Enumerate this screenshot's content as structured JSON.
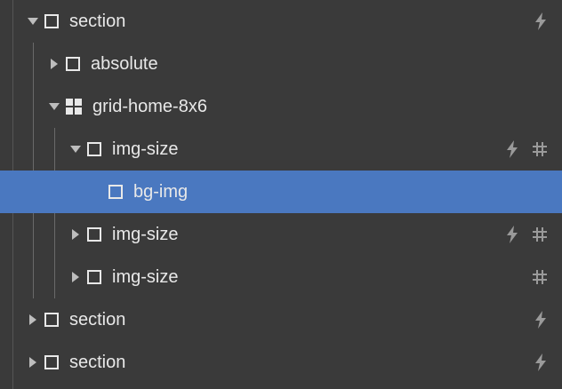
{
  "tree": {
    "items": [
      {
        "label": "section",
        "expanded": true,
        "icon": "box-icon",
        "actions": [
          "bolt-icon"
        ]
      },
      {
        "label": "absolute",
        "expanded": false,
        "icon": "box-icon",
        "actions": []
      },
      {
        "label": "grid-home-8x6",
        "expanded": true,
        "icon": "grid-icon",
        "actions": []
      },
      {
        "label": "img-size",
        "expanded": true,
        "icon": "box-icon",
        "actions": [
          "bolt-icon",
          "hash-icon"
        ]
      },
      {
        "label": "bg-img",
        "expanded": null,
        "icon": "box-icon",
        "actions": [],
        "selected": true
      },
      {
        "label": "img-size",
        "expanded": false,
        "icon": "box-icon",
        "actions": [
          "bolt-icon",
          "hash-icon"
        ]
      },
      {
        "label": "img-size",
        "expanded": false,
        "icon": "box-icon",
        "actions": [
          "hash-icon"
        ]
      },
      {
        "label": "section",
        "expanded": false,
        "icon": "box-icon",
        "actions": [
          "bolt-icon"
        ]
      },
      {
        "label": "section",
        "expanded": false,
        "icon": "box-icon",
        "actions": [
          "bolt-icon"
        ]
      }
    ]
  },
  "colors": {
    "background": "#3a3a3a",
    "selected": "#4a78c0",
    "text": "#e8e8e8",
    "icon_muted": "#9a9a9a"
  }
}
